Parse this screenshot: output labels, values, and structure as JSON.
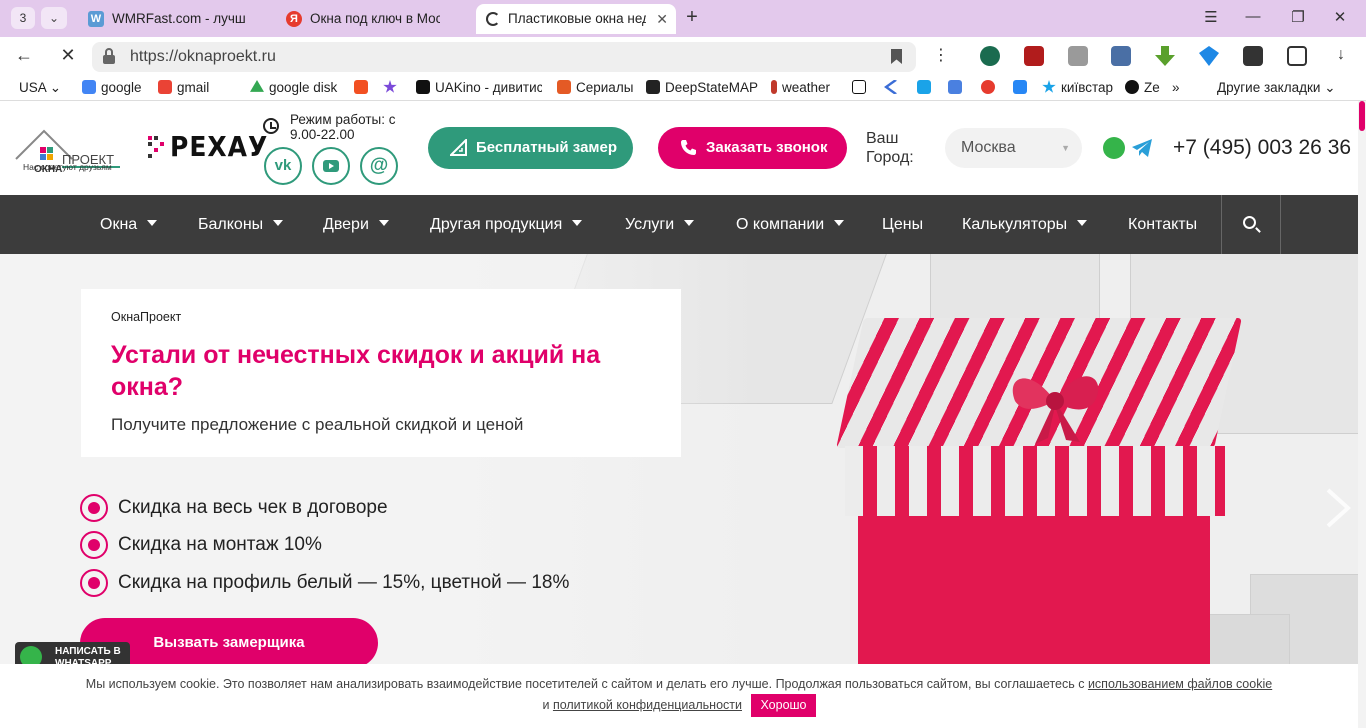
{
  "browser": {
    "tab_count": "3",
    "tabs": [
      {
        "title": "WMRFast.com - лучшее м",
        "fav": "W",
        "fav_color": "#5b9bd5"
      },
      {
        "title": "Окна под ключ в Москве",
        "fav": "Я",
        "fav_color": "#e63b2e"
      },
      {
        "title": "Пластиковые окна неде",
        "fav": "",
        "fav_color": ""
      }
    ],
    "url": "https://oknaproekt.ru",
    "bookmarks": [
      {
        "label": "USA",
        "color": ""
      },
      {
        "label": "google",
        "color": "#4285f4"
      },
      {
        "label": "gmail",
        "color": "#ea4335"
      },
      {
        "label": "google disk",
        "color": "#34a853"
      },
      {
        "label": "",
        "color": "#f25022"
      },
      {
        "label": "",
        "color": "#7b4ad9"
      },
      {
        "label": "UAKino - дивитис",
        "color": "#111"
      },
      {
        "label": "Сериалы",
        "color": "#e45a25"
      },
      {
        "label": "DeepStateMAP",
        "color": "#222"
      },
      {
        "label": "weather",
        "color": "#c0392b"
      },
      {
        "label": "",
        "color": "#111"
      },
      {
        "label": "",
        "color": "#3b6dd6"
      },
      {
        "label": "",
        "color": "#1aa3e8"
      },
      {
        "label": "",
        "color": "#4a80e0"
      },
      {
        "label": "",
        "color": "#e63b2e"
      },
      {
        "label": "",
        "color": "#2787f5"
      },
      {
        "label": "київстар",
        "color": "#1aa3e8"
      },
      {
        "label": "Ze",
        "color": "#111"
      }
    ],
    "other_bookmarks": "Другие закладки"
  },
  "header": {
    "logo_text": "ОКНА ПРОЕКТ",
    "logo_sub": "Нас советуют друзьям",
    "partner": "РЕХАУ",
    "hours": "Режим работы: с 9.00-22.00",
    "measure_btn": "Бесплатный замер",
    "call_btn": "Заказать звонок",
    "city_label": "Ваш Город:",
    "city_value": "Москва",
    "phone": "+7 (495) 003 26 36",
    "social": [
      "vk",
      "yt",
      "@"
    ]
  },
  "nav": [
    {
      "label": "Окна",
      "dropdown": true
    },
    {
      "label": "Балконы",
      "dropdown": true
    },
    {
      "label": "Двери",
      "dropdown": true
    },
    {
      "label": "Другая продукция",
      "dropdown": true
    },
    {
      "label": "Услуги",
      "dropdown": true
    },
    {
      "label": "О компании",
      "dropdown": true
    },
    {
      "label": "Цены",
      "dropdown": false
    },
    {
      "label": "Калькуляторы",
      "dropdown": true
    },
    {
      "label": "Контакты",
      "dropdown": false
    }
  ],
  "hero": {
    "brand": "ОкнаПроект",
    "title": "Устали от нечестных скидок и акций на окна?",
    "subtitle": "Получите предложение с реальной скидкой и ценой",
    "bullets": [
      "Скидка на весь чек в договоре",
      "Скидка на монтаж 10%",
      "Скидка на профиль белый — 15%, цветной — 18%"
    ],
    "cta": "Вызвать замерщика",
    "wa_widget": "НАПИСАТЬ В WHATSAPP"
  },
  "cookie": {
    "text": "Мы используем cookie. Это позволяет нам анализировать взаимодействие посетителей с сайтом и делать его лучше. Продолжая пользоваться сайтом, вы соглашаетесь с ",
    "link1": "использованием файлов cookie",
    "and": " и ",
    "link2": "политикой конфиденциальности",
    "ok": "Хорошо"
  },
  "colors": {
    "brand_pink": "#e0006a",
    "brand_green": "#2f9a7b",
    "nav_bg": "#3c3c3c",
    "tabstrip": "#e3c9ec"
  }
}
